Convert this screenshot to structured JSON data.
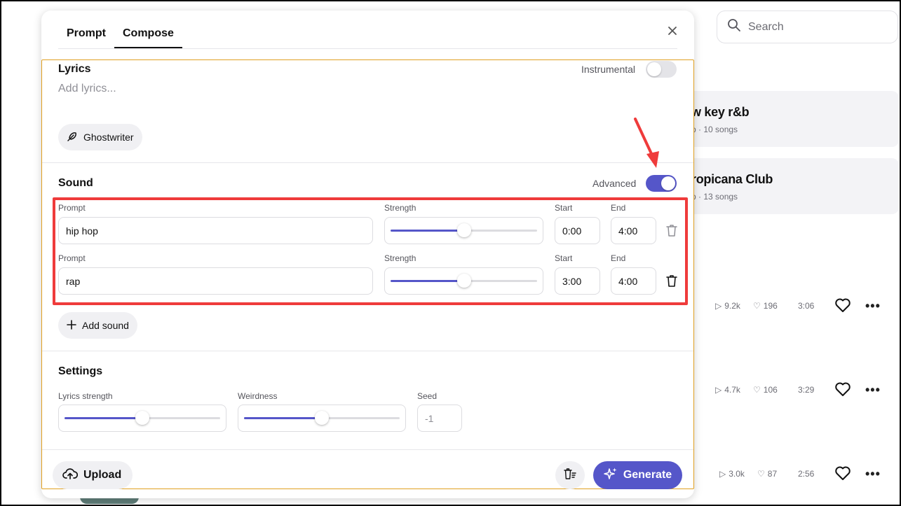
{
  "background": {
    "search_placeholder": "Search",
    "playlists": [
      {
        "title": "w key r&b",
        "meta": "p · 10 songs"
      },
      {
        "title": "ropicana Club",
        "meta": "p · 13 songs"
      }
    ],
    "songs": [
      {
        "plays": "9.2k",
        "likes": "196",
        "duration": "3:06"
      },
      {
        "plays": "4.7k",
        "likes": "106",
        "duration": "3:29"
      },
      {
        "plays": "3.0k",
        "likes": "87",
        "duration": "2:56"
      }
    ]
  },
  "modal": {
    "tabs": [
      {
        "label": "Prompt",
        "active": false
      },
      {
        "label": "Compose",
        "active": true
      }
    ],
    "lyrics": {
      "title": "Lyrics",
      "placeholder": "Add lyrics...",
      "instrumental_label": "Instrumental",
      "instrumental_on": false,
      "ghostwriter_label": "Ghostwriter"
    },
    "sound": {
      "title": "Sound",
      "advanced_label": "Advanced",
      "advanced_on": true,
      "rows": [
        {
          "prompt_label": "Prompt",
          "prompt": "hip hop",
          "strength_label": "Strength",
          "strength": 0.5,
          "start_label": "Start",
          "start": "0:00",
          "end_label": "End",
          "end": "4:00"
        },
        {
          "prompt_label": "Prompt",
          "prompt": "rap",
          "strength_label": "Strength",
          "strength": 0.5,
          "start_label": "Start",
          "start": "3:00",
          "end_label": "End",
          "end": "4:00"
        }
      ],
      "add_sound_label": "Add sound"
    },
    "settings": {
      "title": "Settings",
      "lyrics_strength_label": "Lyrics strength",
      "lyrics_strength": 0.5,
      "weirdness_label": "Weirdness",
      "weirdness": 0.5,
      "seed_label": "Seed",
      "seed_placeholder": "-1"
    },
    "footer": {
      "upload_label": "Upload",
      "generate_label": "Generate"
    }
  },
  "colors": {
    "accent": "#5556c9",
    "highlight": "#ef3b3b"
  }
}
